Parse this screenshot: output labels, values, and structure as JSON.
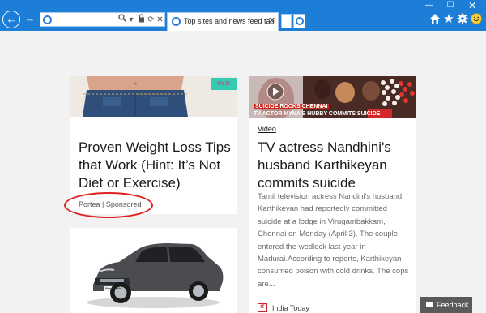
{
  "browser": {
    "address_value": "",
    "active_tab_title": "Top sites and news feed tab",
    "accent_color": "#1c7ed6",
    "icons": [
      "back-arrow-icon",
      "forward-arrow-icon",
      "search-icon",
      "dropdown-icon",
      "lock-icon",
      "refresh-icon",
      "close-icon",
      "new-tab-icon",
      "ie-icon",
      "home-icon",
      "favorites-star-icon",
      "settings-gear-icon",
      "smiley-icon",
      "minimize-icon",
      "maximize-icon",
      "window-close-icon"
    ]
  },
  "feed": {
    "left_card": {
      "thumb_tag": "It's N",
      "title": "Proven Weight Loss Tips that Work (Hint: It’s Not Diet or Exercise)",
      "source": "Portea | Sponsored"
    },
    "left_card2": {
      "car_plate": "New Vento"
    },
    "right_card": {
      "video_top": "SUICIDE ROCKS CHENNAI",
      "video_bottom": "TV ACTOR MYNA'S HUBBY COMMITS SUICIDE",
      "kind": "Video",
      "title": "TV actress Nandhini's husband Karthikeyan commits suicide",
      "summary": "Tamil television actress Nandini's husband Karthikeyan had reportedly committed suicide at a lodge in Virugambakkam, Chennai on Monday (April 3). The couple entered the wedlock last year in Madurai.According to reports, Karthikeyan consumed poison with cold drinks. The cops are...",
      "publisher_logo": "IT",
      "publisher": "India Today"
    }
  },
  "feedback": {
    "label": "Feedback"
  }
}
